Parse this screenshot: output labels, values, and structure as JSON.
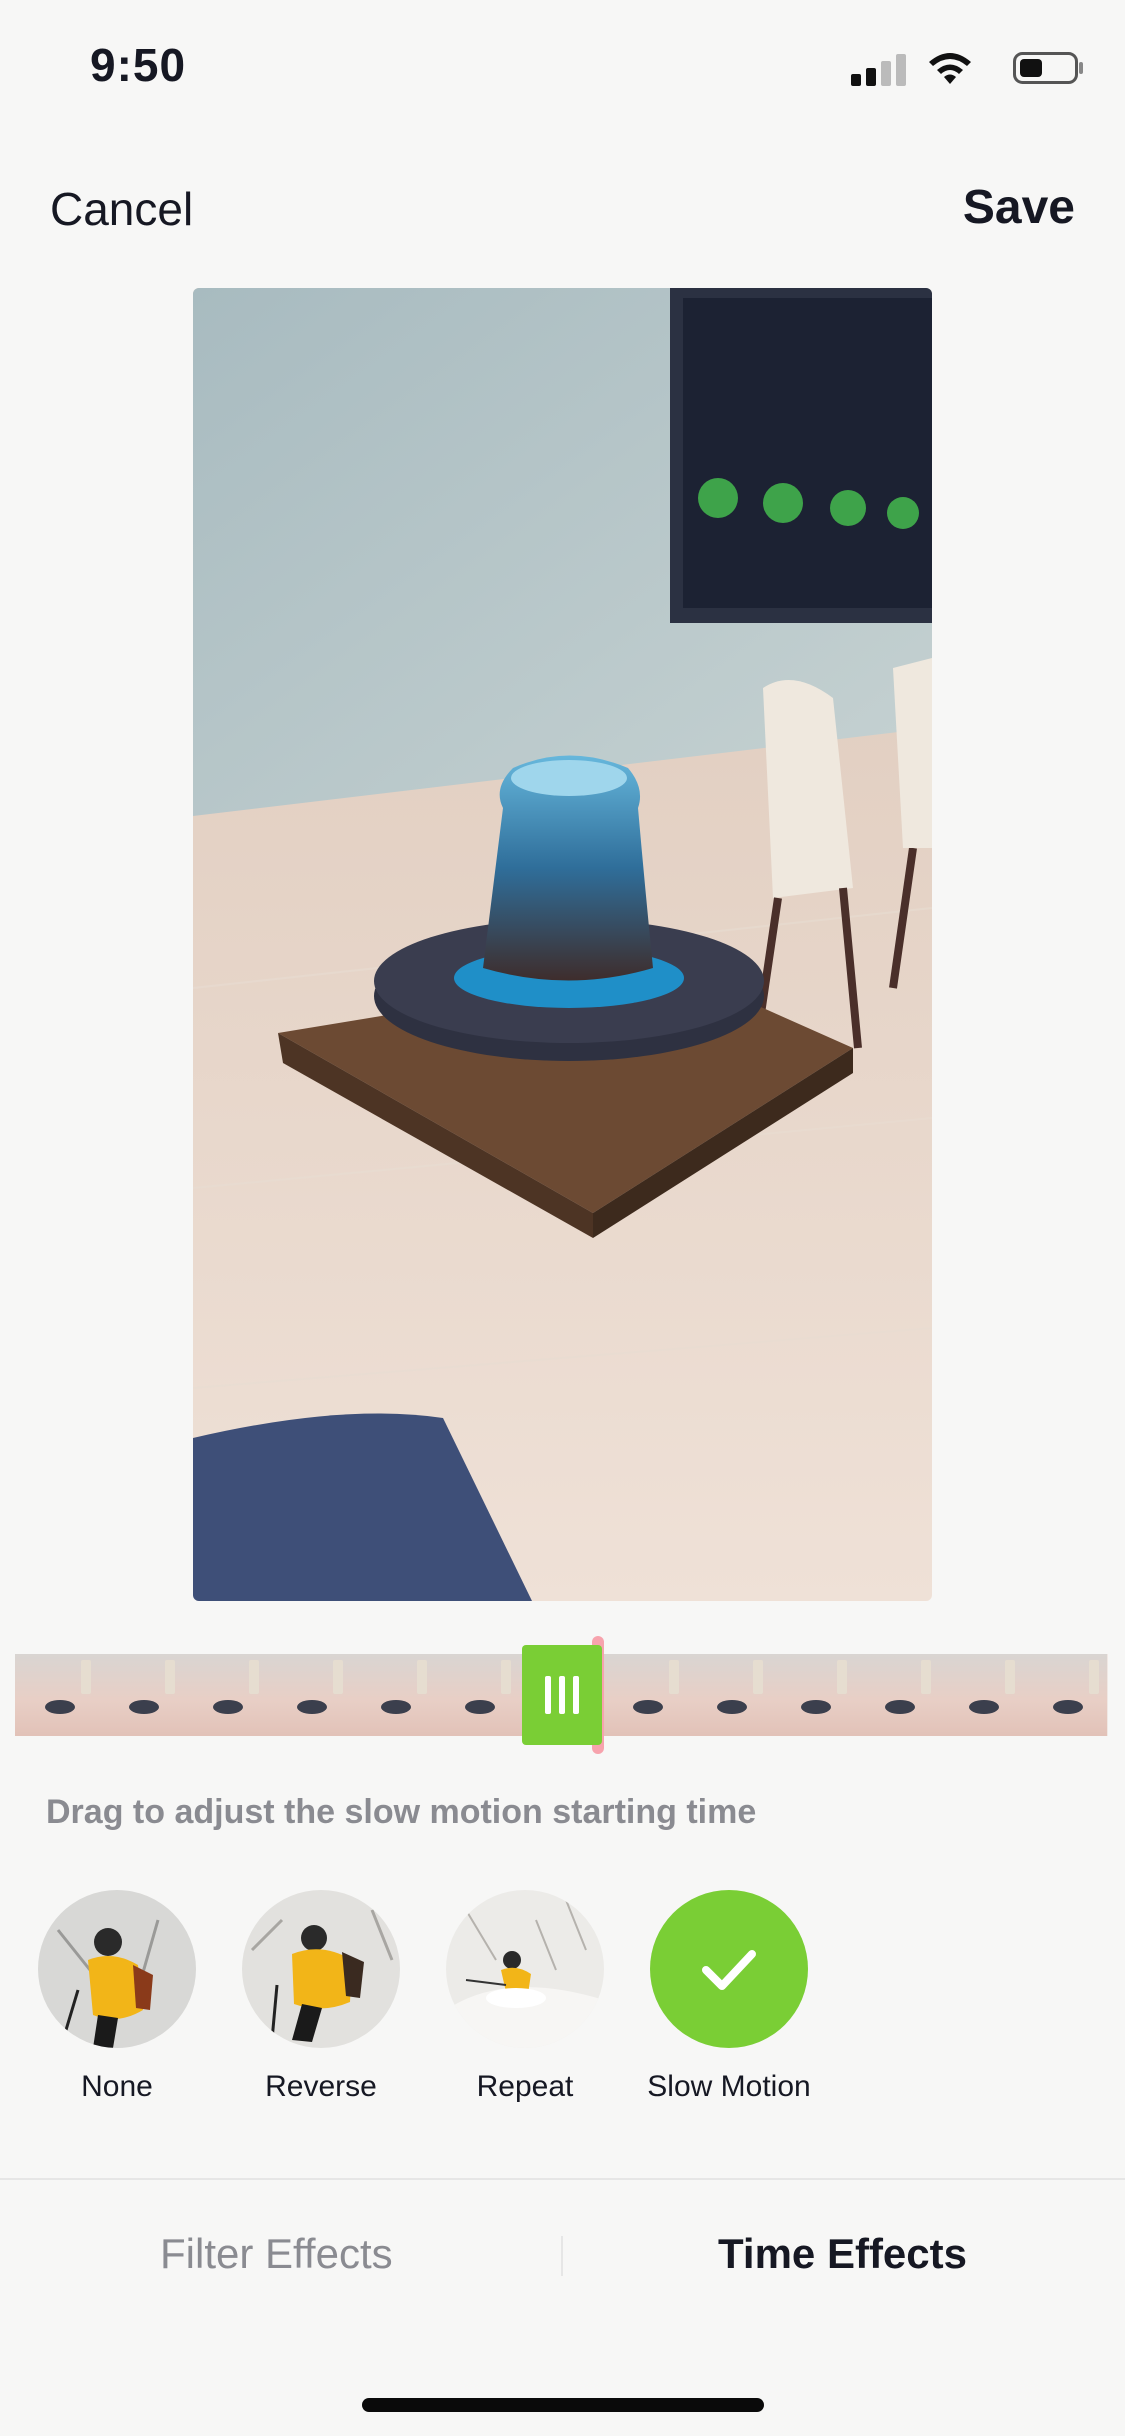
{
  "status_bar": {
    "time": "9:50",
    "battery_level": 0.4
  },
  "nav": {
    "cancel_label": "Cancel",
    "save_label": "Save"
  },
  "preview": {
    "icon": "video-preview"
  },
  "timeline": {
    "handle_icon": "drag-handle-icon"
  },
  "hint": "Drag to adjust the slow motion starting time",
  "effects": [
    {
      "label": "None"
    },
    {
      "label": "Reverse"
    },
    {
      "label": "Repeat"
    },
    {
      "label": "Slow Motion",
      "selected": true
    }
  ],
  "tabs": {
    "filter_label": "Filter Effects",
    "time_label": "Time Effects",
    "active": "Time Effects"
  },
  "colors": {
    "accent": "#7ace35",
    "text": "#161823",
    "muted": "#8a8b91",
    "background": "#f7f7f6"
  }
}
